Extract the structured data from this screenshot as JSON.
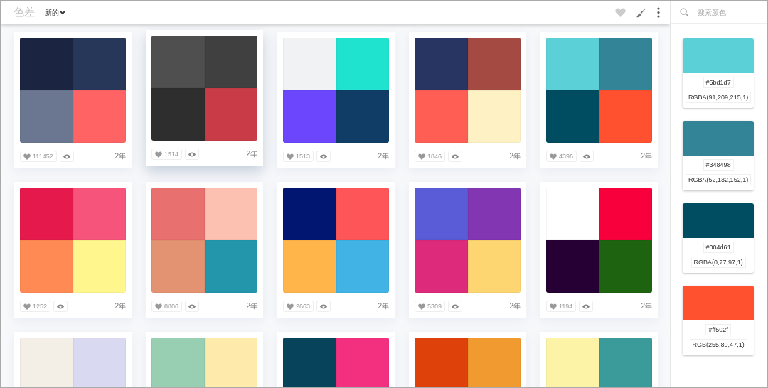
{
  "topbar": {
    "logo": "色差",
    "sort": "新的"
  },
  "palettes": [
    {
      "colors": [
        {
          "color": "#1b2440"
        },
        {
          "color": "#26375a"
        },
        {
          "color": "#6b7690"
        },
        {
          "color": "#ff6363"
        }
      ],
      "likes": "111452",
      "age": "2年",
      "raised": false
    },
    {
      "colors": [
        {
          "color": "#4f4f4f"
        },
        {
          "color": "#404040"
        },
        {
          "color": "#2e2e2e"
        },
        {
          "color": "#c93c47"
        }
      ],
      "likes": "1514",
      "age": "2年",
      "raised": true
    },
    {
      "colors": [
        {
          "color": "#f1f2f4"
        },
        {
          "color": "#1fe3cf"
        },
        {
          "color": "#6c46fc"
        },
        {
          "color": "#103d66"
        }
      ],
      "likes": "1513",
      "age": "2年",
      "raised": false
    },
    {
      "colors": [
        {
          "color": "#283462"
        },
        {
          "color": "#a44a43"
        },
        {
          "color": "#ff5e54"
        },
        {
          "color": "#fef2c4"
        }
      ],
      "likes": "1846",
      "age": "2年",
      "raised": false
    },
    {
      "colors": [
        {
          "color": "#5bd1d7"
        },
        {
          "color": "#348498"
        },
        {
          "color": "#004d61"
        },
        {
          "color": "#ff502f"
        }
      ],
      "likes": "4396",
      "age": "2年",
      "raised": false
    },
    {
      "colors": [
        {
          "color": "#e5194c"
        },
        {
          "color": "#f6547b"
        },
        {
          "color": "#ff8a54"
        },
        {
          "color": "#fff78e"
        }
      ],
      "likes": "1252",
      "age": "2年",
      "raised": false
    },
    {
      "colors": [
        {
          "color": "#e8706e"
        },
        {
          "color": "#fdc1b1"
        },
        {
          "color": "#e39372"
        },
        {
          "color": "#2496ac"
        }
      ],
      "likes": "8806",
      "age": "2年",
      "raised": false
    },
    {
      "colors": [
        {
          "color": "#001670"
        },
        {
          "color": "#fe5559"
        },
        {
          "color": "#ffb54a"
        },
        {
          "color": "#41b3e4"
        }
      ],
      "likes": "2663",
      "age": "2年",
      "raised": false
    },
    {
      "colors": [
        {
          "color": "#5a5bd6"
        },
        {
          "color": "#8236b1"
        },
        {
          "color": "#dd2a7b"
        },
        {
          "color": "#fdd672"
        }
      ],
      "likes": "5309",
      "age": "2年",
      "raised": false
    },
    {
      "colors": [
        {
          "color": "#ffffff"
        },
        {
          "color": "#f7003c"
        },
        {
          "color": "#260034"
        },
        {
          "color": "#1e6410"
        }
      ],
      "likes": "1194",
      "age": "2年",
      "raised": false
    },
    {
      "colors": [
        {
          "color": "#f3efe6"
        },
        {
          "color": "#dad9f2"
        }
      ],
      "raised": false
    },
    {
      "colors": [
        {
          "color": "#98cfb3"
        },
        {
          "color": "#feebab"
        }
      ],
      "raised": false
    },
    {
      "colors": [
        {
          "color": "#08435c"
        },
        {
          "color": "#f3307f"
        }
      ],
      "raised": false
    },
    {
      "colors": [
        {
          "color": "#de420a"
        },
        {
          "color": "#f19a2f"
        }
      ],
      "raised": false
    },
    {
      "colors": [
        {
          "color": "#fcf3a6"
        },
        {
          "color": "#3b9a9a"
        }
      ],
      "raised": false
    }
  ],
  "sidebar": {
    "search": {
      "placeholder": "搜索颜色"
    },
    "swatches": [
      {
        "color": "#5bd1d7",
        "hex": "#5bd1d7",
        "rgba": "RGBA(91,209,215,1)"
      },
      {
        "color": "#348498",
        "hex": "#348498",
        "rgba": "RGBA(52,132,152,1)"
      },
      {
        "color": "#004d61",
        "hex": "#004d61",
        "rgba": "RGBA(0,77,97,1)"
      },
      {
        "color": "#ff502f",
        "hex": "#ff502f",
        "rgba": "RGB(255,80,47,1)"
      }
    ]
  }
}
